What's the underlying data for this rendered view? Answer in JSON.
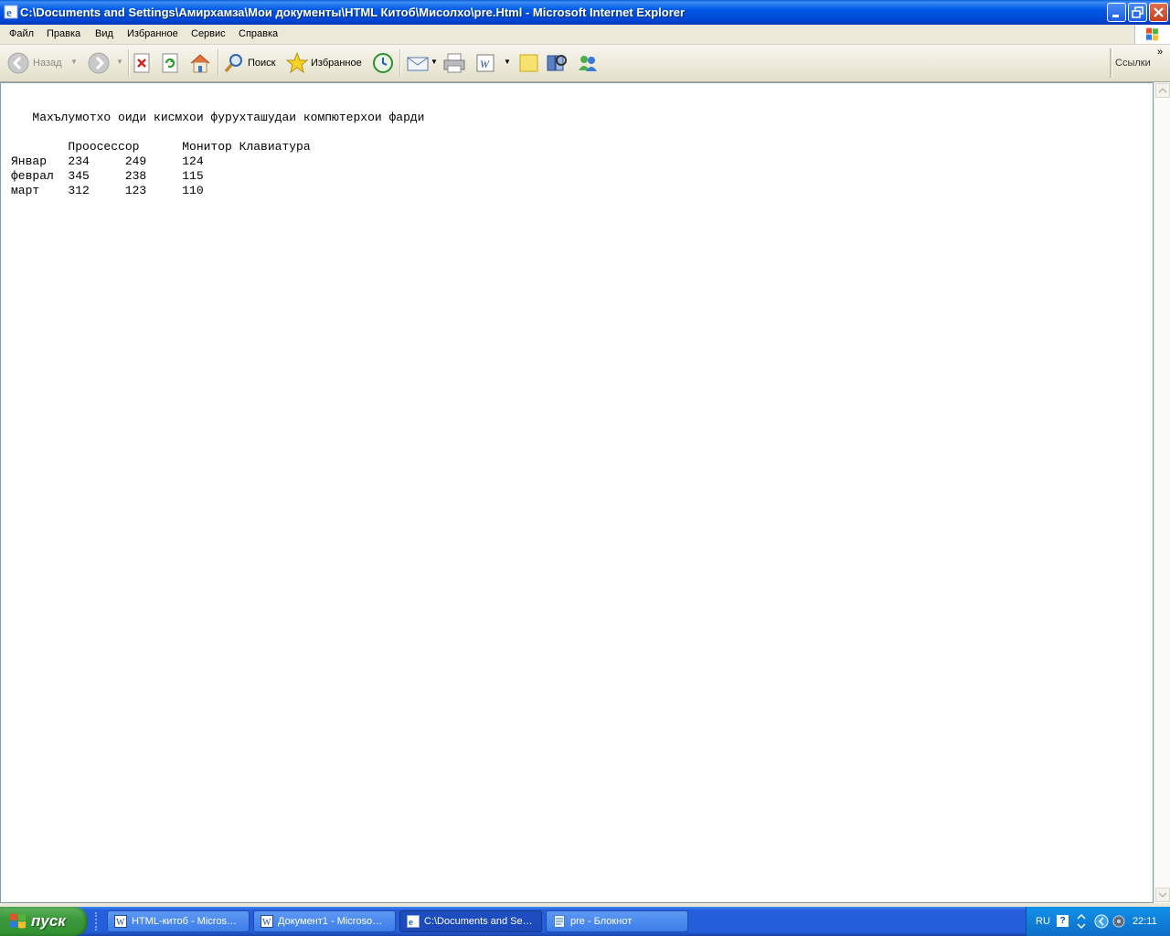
{
  "window": {
    "title": "C:\\Documents and Settings\\Амирхамза\\Мои документы\\HTML Китоб\\Мисолхо\\pre.Html - Microsoft Internet Explorer"
  },
  "menu": [
    "Файл",
    "Правка",
    "Вид",
    "Избранное",
    "Сервис",
    "Справка"
  ],
  "toolbar": {
    "back_label": "Назад",
    "search_label": "Поиск",
    "favorites_label": "Избранное",
    "links_label": "Ссылки",
    "icons": [
      "back-icon",
      "forward-icon",
      "stop-icon",
      "refresh-icon",
      "home-icon",
      "search-icon",
      "favorites-star-icon",
      "history-icon",
      "mail-icon",
      "print-icon",
      "edit-word-icon",
      "discuss-icon",
      "research-icon",
      "messenger-icon"
    ]
  },
  "page": {
    "heading": "   Махълумотхо оиди кисмхои фурухташудаи компютерхои фарди",
    "header_row": "        Проосессор      Монитор Клавиатура",
    "rows": [
      "Январ   234     249     124",
      "феврал  345     238     115",
      "март    312     123     110"
    ]
  },
  "taskbar": {
    "start_label": "пуск",
    "tasks": [
      {
        "label": "HTML-китоб - Micros…",
        "icon": "word-icon"
      },
      {
        "label": "Документ1 - Microso…",
        "icon": "word-icon"
      },
      {
        "label": "C:\\Documents and Se…",
        "icon": "ie-icon",
        "active": true
      },
      {
        "label": "pre - Блокнот",
        "icon": "notepad-icon"
      }
    ],
    "tray": {
      "lang": "RU",
      "help": "?",
      "clock": "22:11"
    }
  },
  "colors": {
    "titlebar": "#0058e6",
    "taskbar": "#245edb",
    "start": "#3c9a3c"
  }
}
